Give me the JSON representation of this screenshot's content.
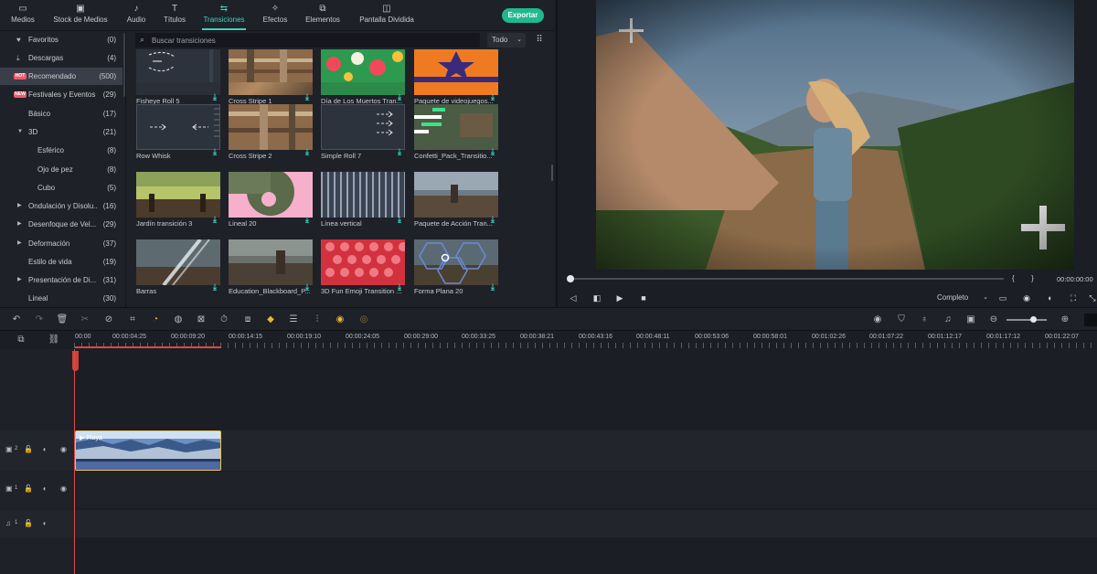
{
  "app": {
    "tabs": [
      {
        "label": "Medios",
        "icon": "folder-icon"
      },
      {
        "label": "Stock de Medios",
        "icon": "stock-media-icon"
      },
      {
        "label": "Audio",
        "icon": "music-note-icon"
      },
      {
        "label": "Títulos",
        "icon": "text-icon"
      },
      {
        "label": "Transiciones",
        "icon": "transitions-icon",
        "active": true
      },
      {
        "label": "Efectos",
        "icon": "effects-icon"
      },
      {
        "label": "Elementos",
        "icon": "elements-icon"
      },
      {
        "label": "Pantalla Dividida",
        "icon": "split-screen-icon"
      }
    ],
    "export_label": "Exportar",
    "accent": "#3fd3c4",
    "export_color": "#1fb88f"
  },
  "sidebar": {
    "items": [
      {
        "label": "Favoritos",
        "count": "(0)",
        "icon": "heart-icon"
      },
      {
        "label": "Descargas",
        "count": "(4)",
        "icon": "download-icon"
      },
      {
        "label": "Recomendado",
        "count": "(500)",
        "badge": "HOT",
        "selected": true
      },
      {
        "label": "Festivales y Eventos",
        "count": "(29)",
        "badge": "NEW"
      },
      {
        "label": "Básico",
        "count": "(17)"
      },
      {
        "label": "3D",
        "count": "(21)",
        "expander": "▼"
      },
      {
        "label": "Esférico",
        "count": "(8)",
        "sub": true
      },
      {
        "label": "Ojo de pez",
        "count": "(8)",
        "sub": true
      },
      {
        "label": "Cubo",
        "count": "(5)",
        "sub": true
      },
      {
        "label": "Ondulación y Disolu...",
        "count": "(16)",
        "expander": "▶"
      },
      {
        "label": "Desenfoque de Vel...",
        "count": "(29)",
        "expander": "▶"
      },
      {
        "label": "Deformación",
        "count": "(37)",
        "expander": "▶"
      },
      {
        "label": "Estilo de vida",
        "count": "(19)"
      },
      {
        "label": "Presentación de Di...",
        "count": "(31)",
        "expander": "▶"
      },
      {
        "label": "Lineal",
        "count": "(30)"
      }
    ]
  },
  "browser": {
    "search_placeholder": "Buscar transiciones",
    "filter_value": "Todo",
    "tiles": [
      {
        "name": "Fisheye Roll 5"
      },
      {
        "name": "Cross Stripe 1"
      },
      {
        "name": "Día de Los Muertos Tran..."
      },
      {
        "name": "Paquete de videojuegos..."
      },
      {
        "name": "Row Whisk"
      },
      {
        "name": "Cross Stripe 2"
      },
      {
        "name": "Simple Roll 7"
      },
      {
        "name": "Confetti_Pack_Transitio..."
      },
      {
        "name": "Jardín transición 3"
      },
      {
        "name": "Lineal 20"
      },
      {
        "name": "Línea vertical"
      },
      {
        "name": "Paquete de Acción Tran..."
      },
      {
        "name": "Barras"
      },
      {
        "name": "Education_Blackboard_P..."
      },
      {
        "name": "3D Fun Emoji Transition ..."
      },
      {
        "name": "Forma Plana 20"
      }
    ]
  },
  "preview": {
    "progress": 0.0,
    "brace_open": "{",
    "brace_close": "}",
    "timecode": "00:00:00:00",
    "quality": "Completo"
  },
  "timeline": {
    "ruler_labels": [
      "00:00",
      "00:00:04:25",
      "00:00:09:20",
      "00:00:14:15",
      "00:00:19:10",
      "00:00:24:05",
      "00:00:29:00",
      "00:00:33:25",
      "00:00:38:21",
      "00:00:43:16",
      "00:00:48:11",
      "00:00:53:06",
      "00:00:58:01",
      "00:01:02:26",
      "00:01:07:22",
      "00:01:12:17",
      "00:01:17:12",
      "00:01:22:07"
    ],
    "tracks": [
      {
        "label": "2",
        "type": "video"
      },
      {
        "label": "1",
        "type": "video"
      },
      {
        "label": "1",
        "type": "audio"
      }
    ],
    "clip_title": "Playa"
  }
}
